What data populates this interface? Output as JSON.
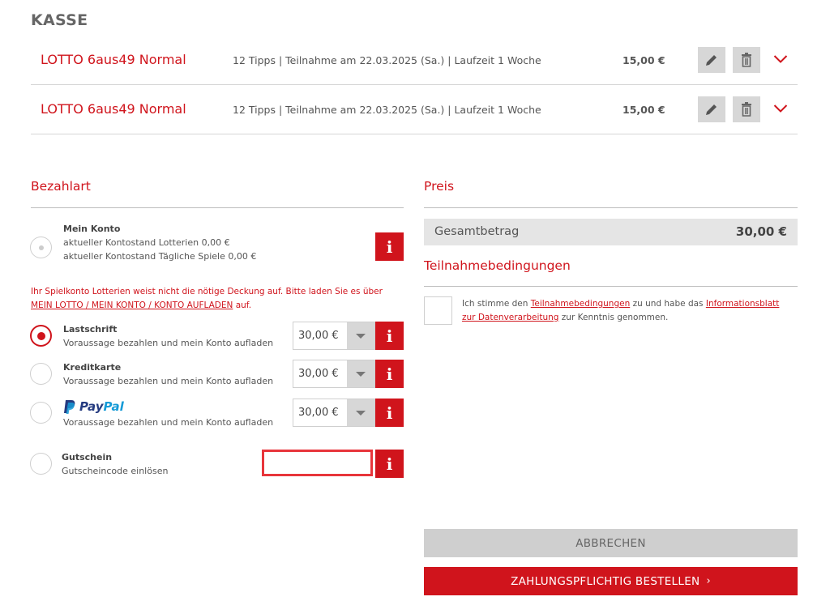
{
  "page": {
    "title": "KASSE"
  },
  "cart": {
    "items": [
      {
        "name": "LOTTO 6aus49 Normal",
        "description": "12 Tipps | Teilnahme am 22.03.2025 (Sa.) | Laufzeit 1 Woche",
        "price": "15,00 €"
      },
      {
        "name": "LOTTO 6aus49 Normal",
        "description": "12 Tipps | Teilnahme am 22.03.2025 (Sa.) | Laufzeit 1 Woche",
        "price": "15,00 €"
      }
    ]
  },
  "payment": {
    "title": "Bezahlart",
    "mein_konto": {
      "title": "Mein Konto",
      "line1": "aktueller Kontostand Lotterien 0,00 €",
      "line2": "aktueller Kontostand Tägliche Spiele 0,00 €"
    },
    "warning": {
      "text": "Ihr Spielkonto Lotterien weist nicht die nötige Deckung auf. Bitte laden Sie es über",
      "link": "MEIN LOTTO / MEIN KONTO / KONTO AUFLADEN",
      "suffix": "auf."
    },
    "methods": [
      {
        "title": "Lastschrift",
        "subtitle": "Voraussage bezahlen und mein Konto aufladen",
        "amount": "30,00 €"
      },
      {
        "title": "Kreditkarte",
        "subtitle": "Voraussage bezahlen und mein Konto aufladen",
        "amount": "30,00 €"
      },
      {
        "title": "PayPal",
        "subtitle": "Voraussage bezahlen und mein Konto aufladen",
        "amount": "30,00 €"
      }
    ],
    "paypal_logo": {
      "part1": "Pay",
      "part2": "Pal"
    },
    "voucher": {
      "title": "Gutschein",
      "subtitle": "Gutscheincode einlösen",
      "value": ""
    },
    "info_label": "i"
  },
  "price": {
    "title": "Preis",
    "total_label": "Gesamtbetrag",
    "total_value": "30,00 €"
  },
  "terms": {
    "title": "Teilnahmebedingungen",
    "text1": "Ich stimme den",
    "link1": "Teilnahmebedingungen",
    "text2": "zu und habe das",
    "link2": "Informationsblatt zur Datenverarbeitung",
    "text3": "zur Kenntnis genommen."
  },
  "actions": {
    "cancel": "ABBRECHEN",
    "order": "ZAHLUNGSPFLICHTIG BESTELLEN",
    "order_chevron": "›"
  },
  "colors": {
    "accent": "#d0141c",
    "gray_button": "#d7d7d7",
    "cancel_bg": "#cfcfcf"
  },
  "icons": {
    "edit": "pencil-icon",
    "delete": "trash-icon",
    "expand": "chevron-down-icon",
    "info": "info-icon",
    "select": "triangle-down-icon",
    "paypal": "paypal-logo"
  }
}
